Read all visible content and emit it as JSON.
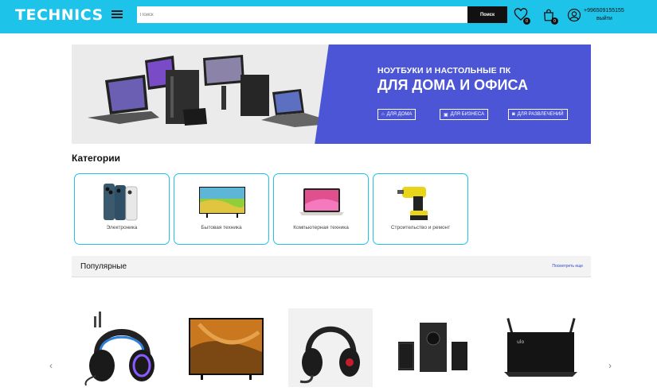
{
  "header": {
    "logo": "TECHNICS",
    "search_placeholder": "Поиск",
    "search_button": "Поиск",
    "favorites_count": "0",
    "cart_count": "0",
    "phone": "+996509155155",
    "logout": "выйти",
    "colors": {
      "bar": "#1ec3ea",
      "search_button": "#111111"
    }
  },
  "banner": {
    "subtitle": "НОУТБУКИ И НАСТОЛЬНЫЕ ПК",
    "title": "ДЛЯ ДОМА И ОФИСА",
    "buttons": [
      {
        "label": "ДЛЯ ДОМА",
        "icon": "home-icon"
      },
      {
        "label": "ДЛЯ БИЗНЕСА",
        "icon": "briefcase-icon"
      },
      {
        "label": "ДЛЯ РАЗВЛЕЧЕНИЙ",
        "icon": "gamepad-icon"
      }
    ],
    "colors": {
      "accent": "#4b55d6"
    }
  },
  "categories": {
    "title": "Категории",
    "items": [
      {
        "label": "Электроника",
        "image": "smartphones"
      },
      {
        "label": "Бытовая техника",
        "image": "tv"
      },
      {
        "label": "Компьютерная техника",
        "image": "laptop"
      },
      {
        "label": "Строительство и ремонт",
        "image": "drill"
      }
    ]
  },
  "popular": {
    "title": "Популярные",
    "see_all": "Посмотреть еще",
    "products": [
      {
        "image": "gaming-headset-blue"
      },
      {
        "image": "samsung-tv"
      },
      {
        "image": "gaming-headset-red"
      },
      {
        "image": "speaker-system"
      },
      {
        "image": "router"
      }
    ]
  }
}
